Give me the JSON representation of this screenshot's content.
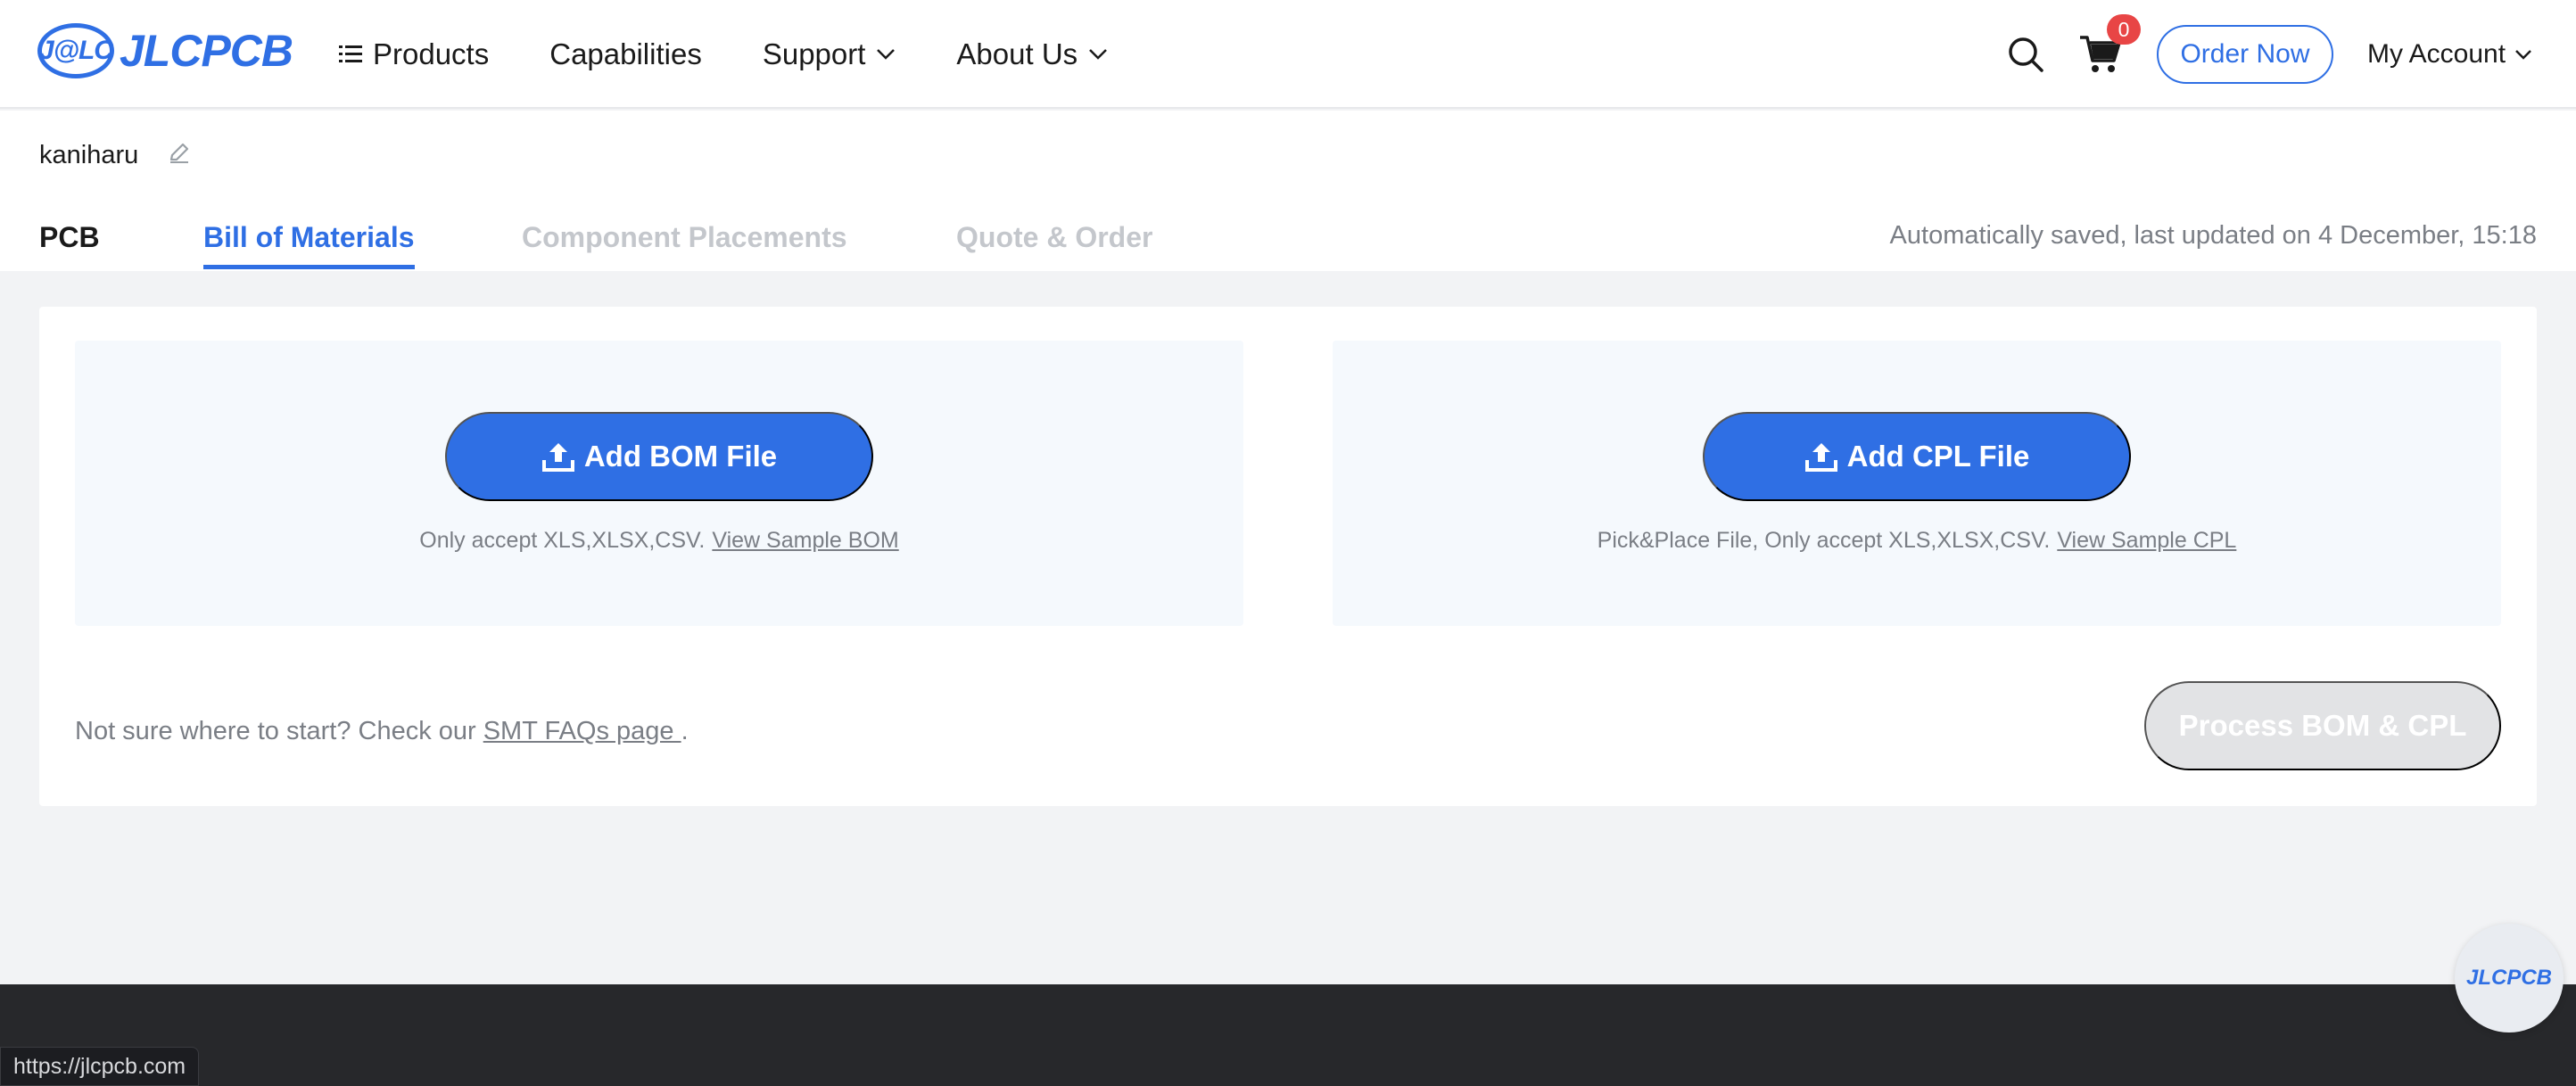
{
  "brand": {
    "logo_badge": "J@LC",
    "logo_text": "JLCPCB"
  },
  "nav": {
    "products": "Products",
    "capabilities": "Capabilities",
    "support": "Support",
    "about": "About Us"
  },
  "header_right": {
    "cart_count": "0",
    "order_now": "Order Now",
    "my_account": "My Account"
  },
  "project": {
    "name": "kaniharu",
    "tabs": [
      {
        "label": "PCB",
        "state": "done"
      },
      {
        "label": "Bill of Materials",
        "state": "active"
      },
      {
        "label": "Component Placements",
        "state": "disabled"
      },
      {
        "label": "Quote & Order",
        "state": "disabled"
      }
    ],
    "autosave": "Automatically saved, last updated on 4 December, 15:18"
  },
  "bom": {
    "button": "Add BOM File",
    "hint": "Only accept XLS,XLSX,CSV.",
    "sample_link": "View Sample BOM"
  },
  "cpl": {
    "button": "Add CPL File",
    "hint": "Pick&Place File, Only accept XLS,XLSX,CSV.",
    "sample_link": "View Sample CPL"
  },
  "help": {
    "text": "Not sure where to start? Check our",
    "link": "SMT FAQs page ",
    "suffix": "."
  },
  "process_button": "Process BOM & CPL",
  "status_bar_url": "https://jlcpcb.com",
  "float_badge": "JLCPCB",
  "colors": {
    "accent": "#2f6fe4",
    "disabled_text": "#c4c7cc",
    "muted_text": "#7a7e85",
    "badge_red": "#e84545",
    "footer": "#27282b"
  }
}
